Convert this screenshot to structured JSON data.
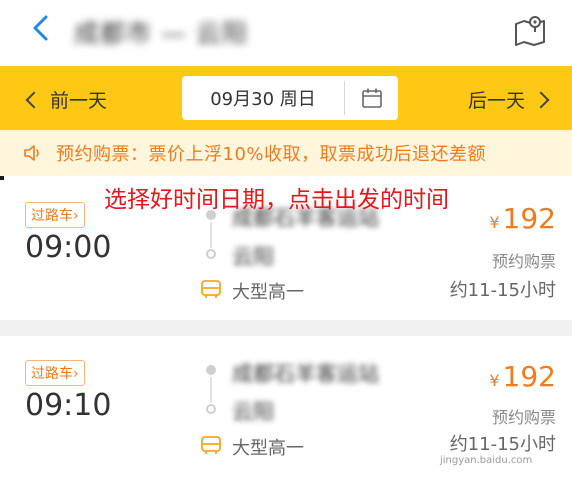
{
  "header": {
    "route_title": "成都市 — 云阳",
    "back_icon": "chevron-left-icon",
    "map_icon": "map-icon"
  },
  "datebar": {
    "prev_label": "前一天",
    "next_label": "后一天",
    "date_text": "09月30 周日",
    "calendar_icon": "calendar-icon",
    "background_color": "#FFC815"
  },
  "notice": {
    "icon": "speaker-icon",
    "text": "预约购票：票价上浮10%收取，取票成功后退还差额",
    "text_color": "#F07B1E"
  },
  "caption": {
    "text": "选择好时间日期，点击出发的时间",
    "color": "#E8151B"
  },
  "buses": [
    {
      "tag": "过路车",
      "time": "09:00",
      "from": "成都石羊客运站",
      "to": "云阳",
      "bus_type": "大型高一",
      "currency": "¥",
      "price": "192",
      "presale": "预约购票",
      "duration": "约11-15小时"
    },
    {
      "tag": "过路车",
      "time": "09:10",
      "from": "成都石羊客运站",
      "to": "云阳",
      "bus_type": "大型高一",
      "currency": "¥",
      "price": "192",
      "presale": "预约购票",
      "duration": "约11-15小时"
    }
  ],
  "watermark": "jingyan.baidu.com"
}
